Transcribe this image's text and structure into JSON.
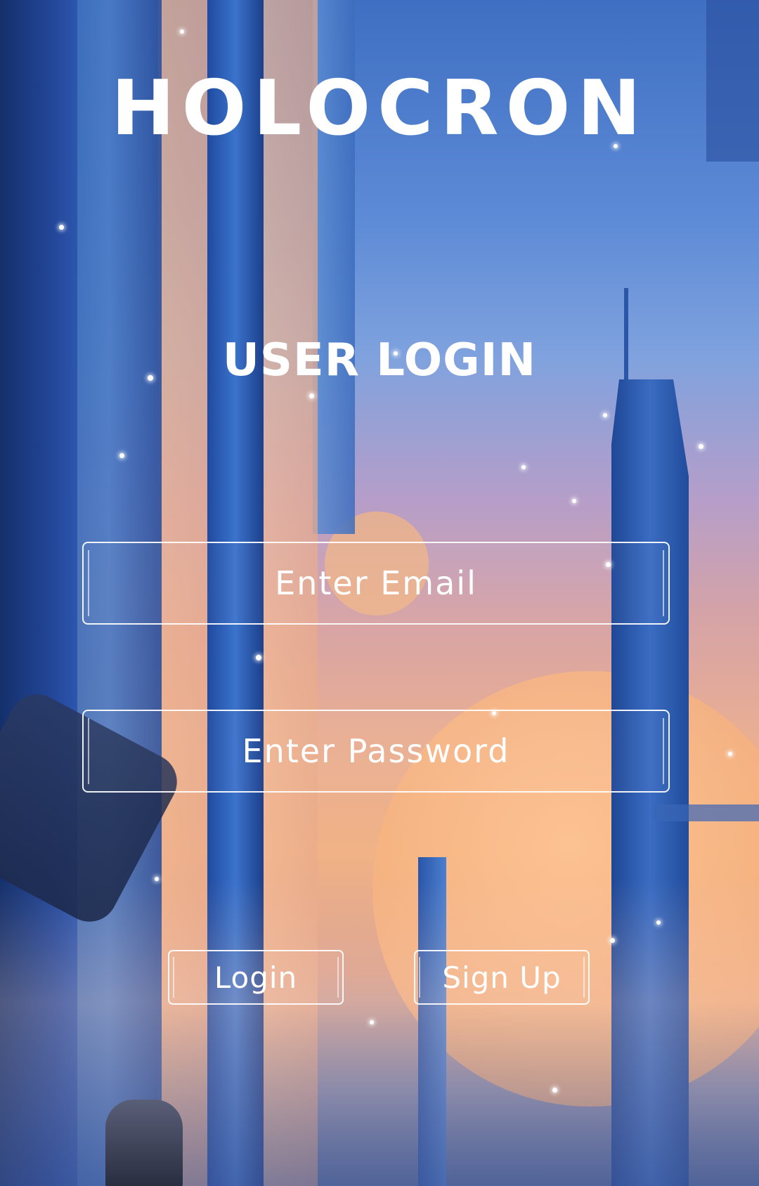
{
  "app": {
    "brand": "HOLOCRON",
    "heading": "USER LOGIN"
  },
  "form": {
    "email_placeholder": "Enter Email",
    "password_placeholder": "Enter Password",
    "login_label": "Login",
    "signup_label": "Sign Up"
  },
  "colors": {
    "text": "#ffffff",
    "sky_top": "#3f6fc2",
    "sunset": "#f0b286"
  }
}
